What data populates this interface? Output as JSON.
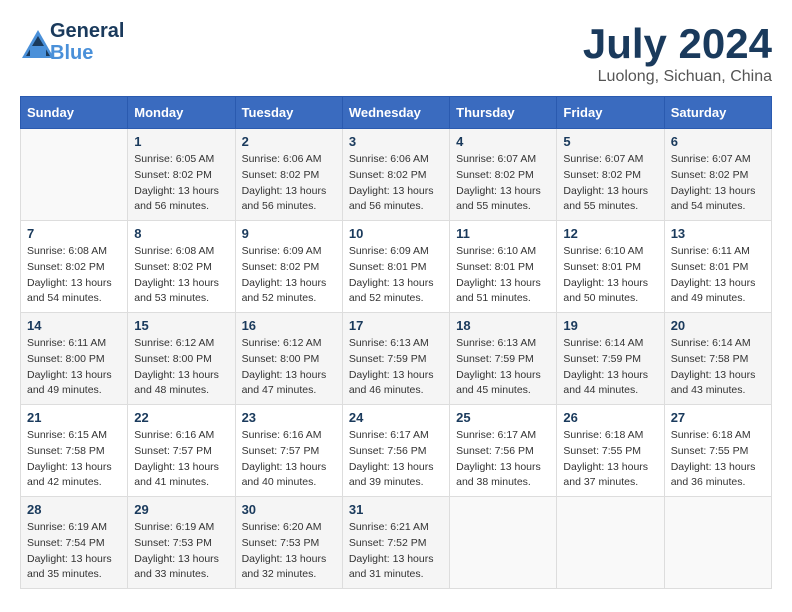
{
  "header": {
    "logo_line1": "General",
    "logo_line2": "Blue",
    "title": "July 2024",
    "subtitle": "Luolong, Sichuan, China"
  },
  "weekdays": [
    "Sunday",
    "Monday",
    "Tuesday",
    "Wednesday",
    "Thursday",
    "Friday",
    "Saturday"
  ],
  "weeks": [
    [
      {
        "day": "",
        "info": ""
      },
      {
        "day": "1",
        "info": "Sunrise: 6:05 AM\nSunset: 8:02 PM\nDaylight: 13 hours\nand 56 minutes."
      },
      {
        "day": "2",
        "info": "Sunrise: 6:06 AM\nSunset: 8:02 PM\nDaylight: 13 hours\nand 56 minutes."
      },
      {
        "day": "3",
        "info": "Sunrise: 6:06 AM\nSunset: 8:02 PM\nDaylight: 13 hours\nand 56 minutes."
      },
      {
        "day": "4",
        "info": "Sunrise: 6:07 AM\nSunset: 8:02 PM\nDaylight: 13 hours\nand 55 minutes."
      },
      {
        "day": "5",
        "info": "Sunrise: 6:07 AM\nSunset: 8:02 PM\nDaylight: 13 hours\nand 55 minutes."
      },
      {
        "day": "6",
        "info": "Sunrise: 6:07 AM\nSunset: 8:02 PM\nDaylight: 13 hours\nand 54 minutes."
      }
    ],
    [
      {
        "day": "7",
        "info": "Sunrise: 6:08 AM\nSunset: 8:02 PM\nDaylight: 13 hours\nand 54 minutes."
      },
      {
        "day": "8",
        "info": "Sunrise: 6:08 AM\nSunset: 8:02 PM\nDaylight: 13 hours\nand 53 minutes."
      },
      {
        "day": "9",
        "info": "Sunrise: 6:09 AM\nSunset: 8:02 PM\nDaylight: 13 hours\nand 52 minutes."
      },
      {
        "day": "10",
        "info": "Sunrise: 6:09 AM\nSunset: 8:01 PM\nDaylight: 13 hours\nand 52 minutes."
      },
      {
        "day": "11",
        "info": "Sunrise: 6:10 AM\nSunset: 8:01 PM\nDaylight: 13 hours\nand 51 minutes."
      },
      {
        "day": "12",
        "info": "Sunrise: 6:10 AM\nSunset: 8:01 PM\nDaylight: 13 hours\nand 50 minutes."
      },
      {
        "day": "13",
        "info": "Sunrise: 6:11 AM\nSunset: 8:01 PM\nDaylight: 13 hours\nand 49 minutes."
      }
    ],
    [
      {
        "day": "14",
        "info": "Sunrise: 6:11 AM\nSunset: 8:00 PM\nDaylight: 13 hours\nand 49 minutes."
      },
      {
        "day": "15",
        "info": "Sunrise: 6:12 AM\nSunset: 8:00 PM\nDaylight: 13 hours\nand 48 minutes."
      },
      {
        "day": "16",
        "info": "Sunrise: 6:12 AM\nSunset: 8:00 PM\nDaylight: 13 hours\nand 47 minutes."
      },
      {
        "day": "17",
        "info": "Sunrise: 6:13 AM\nSunset: 7:59 PM\nDaylight: 13 hours\nand 46 minutes."
      },
      {
        "day": "18",
        "info": "Sunrise: 6:13 AM\nSunset: 7:59 PM\nDaylight: 13 hours\nand 45 minutes."
      },
      {
        "day": "19",
        "info": "Sunrise: 6:14 AM\nSunset: 7:59 PM\nDaylight: 13 hours\nand 44 minutes."
      },
      {
        "day": "20",
        "info": "Sunrise: 6:14 AM\nSunset: 7:58 PM\nDaylight: 13 hours\nand 43 minutes."
      }
    ],
    [
      {
        "day": "21",
        "info": "Sunrise: 6:15 AM\nSunset: 7:58 PM\nDaylight: 13 hours\nand 42 minutes."
      },
      {
        "day": "22",
        "info": "Sunrise: 6:16 AM\nSunset: 7:57 PM\nDaylight: 13 hours\nand 41 minutes."
      },
      {
        "day": "23",
        "info": "Sunrise: 6:16 AM\nSunset: 7:57 PM\nDaylight: 13 hours\nand 40 minutes."
      },
      {
        "day": "24",
        "info": "Sunrise: 6:17 AM\nSunset: 7:56 PM\nDaylight: 13 hours\nand 39 minutes."
      },
      {
        "day": "25",
        "info": "Sunrise: 6:17 AM\nSunset: 7:56 PM\nDaylight: 13 hours\nand 38 minutes."
      },
      {
        "day": "26",
        "info": "Sunrise: 6:18 AM\nSunset: 7:55 PM\nDaylight: 13 hours\nand 37 minutes."
      },
      {
        "day": "27",
        "info": "Sunrise: 6:18 AM\nSunset: 7:55 PM\nDaylight: 13 hours\nand 36 minutes."
      }
    ],
    [
      {
        "day": "28",
        "info": "Sunrise: 6:19 AM\nSunset: 7:54 PM\nDaylight: 13 hours\nand 35 minutes."
      },
      {
        "day": "29",
        "info": "Sunrise: 6:19 AM\nSunset: 7:53 PM\nDaylight: 13 hours\nand 33 minutes."
      },
      {
        "day": "30",
        "info": "Sunrise: 6:20 AM\nSunset: 7:53 PM\nDaylight: 13 hours\nand 32 minutes."
      },
      {
        "day": "31",
        "info": "Sunrise: 6:21 AM\nSunset: 7:52 PM\nDaylight: 13 hours\nand 31 minutes."
      },
      {
        "day": "",
        "info": ""
      },
      {
        "day": "",
        "info": ""
      },
      {
        "day": "",
        "info": ""
      }
    ]
  ]
}
